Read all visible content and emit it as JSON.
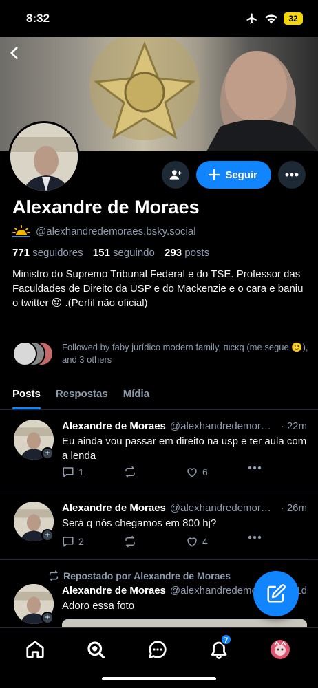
{
  "status_bar": {
    "time": "8:32",
    "battery": "32"
  },
  "profile": {
    "name": "Alexandre de Moraes",
    "handle": "@alexhandredemoraes.bsky.social",
    "follow_label": "Seguir",
    "stats": {
      "followers_count": "771",
      "followers_label": "seguidores",
      "following_count": "151",
      "following_label": "seguindo",
      "posts_count": "293",
      "posts_label": "posts"
    },
    "bio": "Ministro do Supremo Tribunal Federal e do TSE. Professor das Faculdades de Direito da USP e do Mackenzie e o cara e baniu o twitter 😝 .(Perfil não oficial)",
    "followed_by": "Followed by faby jurídico modern family, пιcκq (me segue 🙂), and 3 others"
  },
  "tabs": [
    {
      "label": "Posts"
    },
    {
      "label": "Respostas"
    },
    {
      "label": "Mídia"
    }
  ],
  "posts": [
    {
      "author": "Alexandre de Moraes",
      "handle": "@alexhandredemoraes.bsky.social",
      "time": "· 22m",
      "text": "Eu ainda vou passar em direito na usp e ter aula com a lenda",
      "replies": "1",
      "likes": "6"
    },
    {
      "author": "Alexandre de Moraes",
      "handle": "@alexhandredemoraes.bsky.social",
      "time": "· 26m",
      "text": "Será q nós chegamos em 800 hj?",
      "replies": "2",
      "likes": "4"
    },
    {
      "repost_label": "Repostado por Alexandre de Moraes",
      "author": "Alexandre de Moraes",
      "handle": "@alexhandredemoraes.bsky.social",
      "time": "· 1d",
      "text": "Adoro essa foto"
    }
  ],
  "bottom_nav": {
    "notifications_badge": "7"
  },
  "colors": {
    "accent": "#1185fe",
    "background": "#000000",
    "muted": "#8d9bad"
  }
}
